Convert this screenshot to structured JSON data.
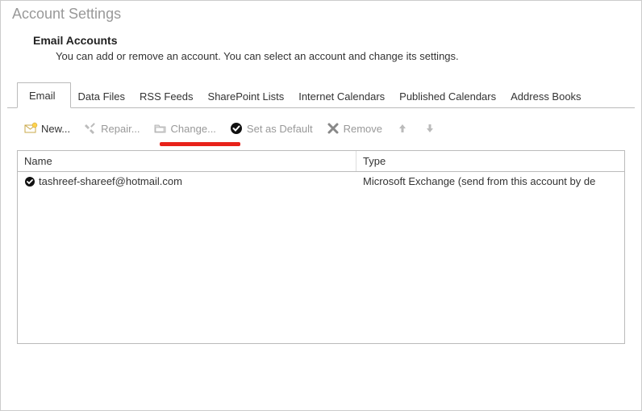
{
  "page": {
    "title": "Account Settings"
  },
  "header": {
    "title": "Email Accounts",
    "description": "You can add or remove an account. You can select an account and change its settings."
  },
  "tabs": {
    "t0": "Email",
    "t1": "Data Files",
    "t2": "RSS Feeds",
    "t3": "SharePoint Lists",
    "t4": "Internet Calendars",
    "t5": "Published Calendars",
    "t6": "Address Books"
  },
  "toolbar": {
    "new_label": "New...",
    "repair_label": "Repair...",
    "change_label": "Change...",
    "default_label": "Set as Default",
    "remove_label": "Remove"
  },
  "list": {
    "col_name": "Name",
    "col_type": "Type",
    "row0_name": "tashreef-shareef@hotmail.com",
    "row0_type": "Microsoft Exchange (send from this account by de"
  }
}
